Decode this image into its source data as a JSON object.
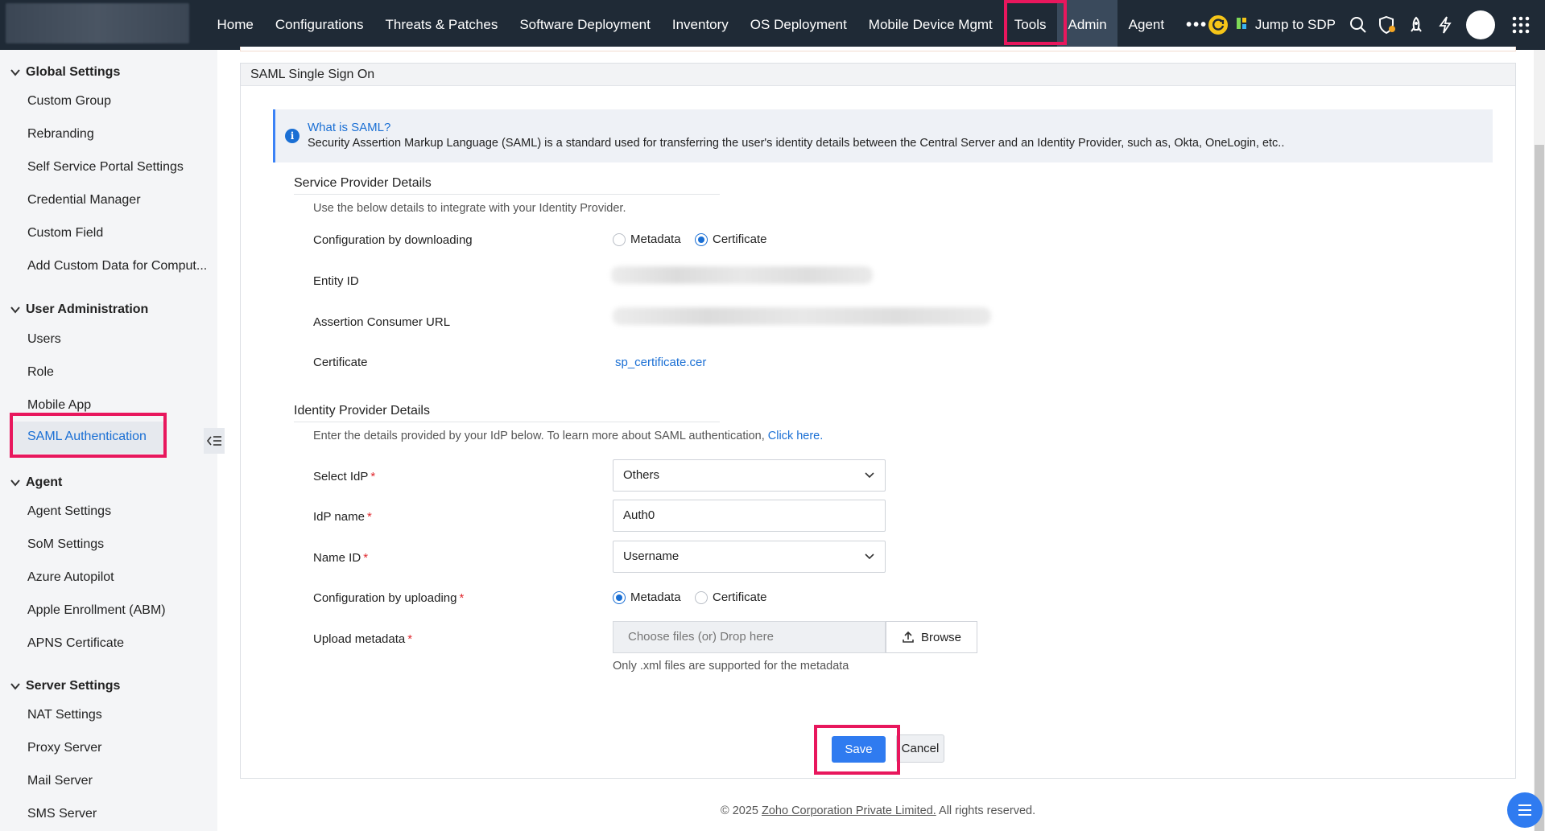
{
  "nav": {
    "items": [
      "Home",
      "Configurations",
      "Threats & Patches",
      "Software Deployment",
      "Inventory",
      "OS Deployment",
      "Mobile Device Mgmt",
      "Tools",
      "Admin",
      "Agent"
    ],
    "more": "•••",
    "jump_to_sdp": "Jump to SDP"
  },
  "sidebar": {
    "global_settings": {
      "title": "Global Settings",
      "items": [
        "Custom Group",
        "Rebranding",
        "Self Service Portal Settings",
        "Credential Manager",
        "Custom Field",
        "Add Custom Data for Comput..."
      ]
    },
    "user_administration": {
      "title": "User Administration",
      "items": [
        "Users",
        "Role",
        "Mobile App",
        "SAML Authentication"
      ]
    },
    "agent": {
      "title": "Agent",
      "items": [
        "Agent Settings",
        "SoM Settings",
        "Azure Autopilot",
        "Apple Enrollment (ABM)",
        "APNS Certificate"
      ]
    },
    "server_settings": {
      "title": "Server Settings",
      "items": [
        "NAT Settings",
        "Proxy Server",
        "Mail Server",
        "SMS Server"
      ]
    }
  },
  "page": {
    "title": "SAML Single Sign On",
    "info": {
      "title": "What is SAML?",
      "text": "Security Assertion Markup Language (SAML) is a standard used for transferring the user's identity details between the Central Server and an Identity Provider, such as, Okta, OneLogin, etc.."
    },
    "sp": {
      "title": "Service Provider Details",
      "desc": "Use the below details to integrate with your Identity Provider.",
      "config_label": "Configuration by downloading",
      "config_options": [
        "Metadata",
        "Certificate"
      ],
      "config_selected": "Certificate",
      "entity_id_label": "Entity ID",
      "acs_label": "Assertion Consumer URL",
      "certificate_label": "Certificate",
      "certificate_link": "sp_certificate.cer"
    },
    "idp": {
      "title": "Identity Provider Details",
      "desc": "Enter the details provided by your IdP below. To learn more about SAML authentication, ",
      "desc_link": "Click here.",
      "select_idp_label": "Select IdP",
      "select_idp_value": "Others",
      "idp_name_label": "IdP name",
      "idp_name_value": "Auth0",
      "name_id_label": "Name ID",
      "name_id_value": "Username",
      "upload_config_label": "Configuration by uploading",
      "upload_config_options": [
        "Metadata",
        "Certificate"
      ],
      "upload_config_selected": "Metadata",
      "upload_label": "Upload metadata",
      "upload_placeholder": "Choose files (or) Drop here",
      "browse_label": "Browse",
      "upload_hint": "Only .xml files are supported for the metadata"
    },
    "save_label": "Save",
    "cancel_label": "Cancel"
  },
  "footer": {
    "prefix": "© 2025 ",
    "company": "Zoho Corporation Private Limited.",
    "suffix": " All rights reserved."
  },
  "colors": {
    "topbar": "#1f2a36",
    "accent": "#1a6fd4",
    "highlight": "#e8175d",
    "primary_button": "#2f7bf0"
  }
}
